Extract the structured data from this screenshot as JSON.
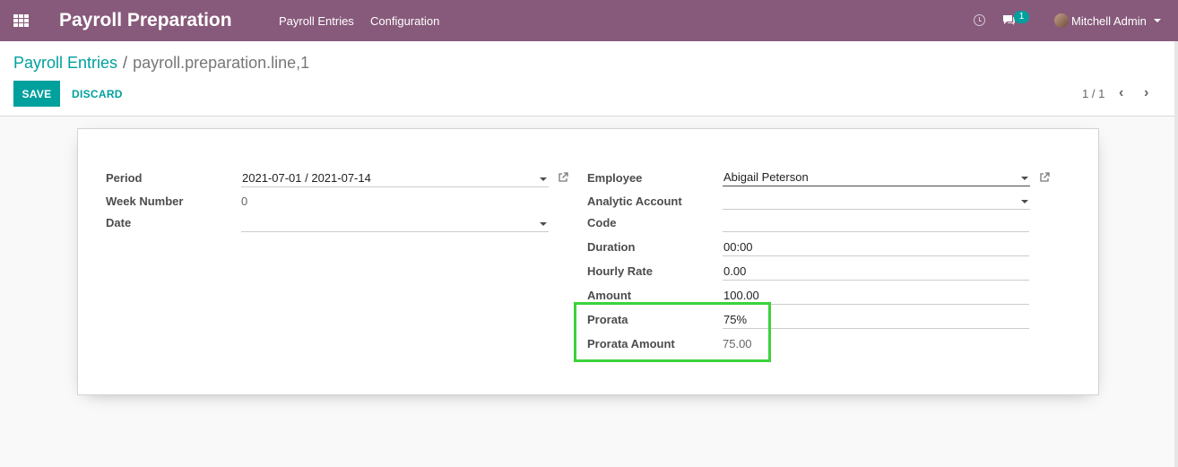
{
  "navbar": {
    "app_title": "Payroll Preparation",
    "menu": [
      "Payroll Entries",
      "Configuration"
    ],
    "message_count": "1",
    "user_name": "Mitchell Admin"
  },
  "breadcrumb": {
    "parent": "Payroll Entries",
    "separator": "/",
    "current": "payroll.preparation.line,1"
  },
  "actions": {
    "save": "SAVE",
    "discard": "DISCARD"
  },
  "pager": {
    "text": "1 / 1"
  },
  "form": {
    "left": {
      "period_label": "Period",
      "period_value": "2021-07-01 / 2021-07-14",
      "week_number_label": "Week Number",
      "week_number_value": "0",
      "date_label": "Date",
      "date_value": ""
    },
    "right": {
      "employee_label": "Employee",
      "employee_value": "Abigail Peterson",
      "analytic_account_label": "Analytic Account",
      "analytic_account_value": "",
      "code_label": "Code",
      "code_value": "",
      "duration_label": "Duration",
      "duration_value": "00:00",
      "hourly_rate_label": "Hourly Rate",
      "hourly_rate_value": "0.00",
      "amount_label": "Amount",
      "amount_value": "100.00",
      "prorata_label": "Prorata",
      "prorata_value": "75%",
      "prorata_amount_label": "Prorata Amount",
      "prorata_amount_value": "75.00"
    }
  },
  "colors": {
    "navbar": "#875a7b",
    "accent": "#00a09d",
    "highlight": "#3bd23b"
  }
}
